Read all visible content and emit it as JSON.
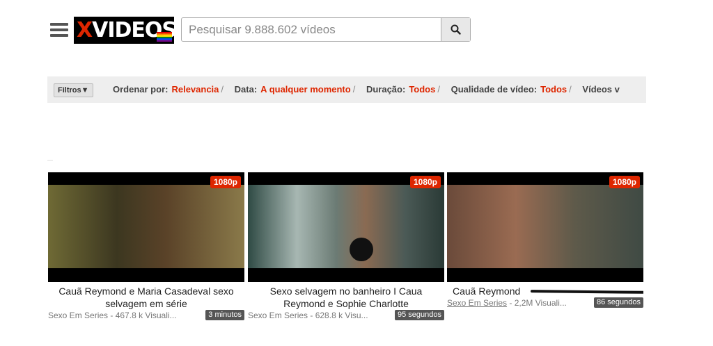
{
  "header": {
    "logo_text": "XVIDEOS",
    "search": {
      "placeholder": "Pesquisar 9.888.602 vídeos",
      "value": ""
    }
  },
  "filters": {
    "button_label": "Filtros▼",
    "items": [
      {
        "label": "Ordenar por:",
        "value": "Relevancia"
      },
      {
        "label": "Data:",
        "value": "A qualquer momento"
      },
      {
        "label": "Duração:",
        "value": "Todos"
      },
      {
        "label": "Qualidade de vídeo:",
        "value": "Todos"
      },
      {
        "label": "Vídeos v",
        "value": ""
      }
    ]
  },
  "videos": [
    {
      "title": "Cauã Reymond e Maria Casadeval sexo selvagem em série",
      "quality": "1080p",
      "channel": "Sexo Em Series",
      "views": " - 467.8 k Visuali...",
      "duration": "3 minutos"
    },
    {
      "title": "Sexo selvagem no banheiro I Caua Reymond e Sophie Charlotte",
      "quality": "1080p",
      "channel": "Sexo Em Series",
      "views": " - 628.8 k Visu...",
      "duration": "95 segundos"
    },
    {
      "title": "Cauã Reymond",
      "quality": "1080p",
      "channel": "Sexo Em Series",
      "views": " - 2,2M Visuali...",
      "duration": "86 segundos"
    }
  ],
  "colors": {
    "accent": "#de2600",
    "filter_bar": "#eeeeee"
  }
}
